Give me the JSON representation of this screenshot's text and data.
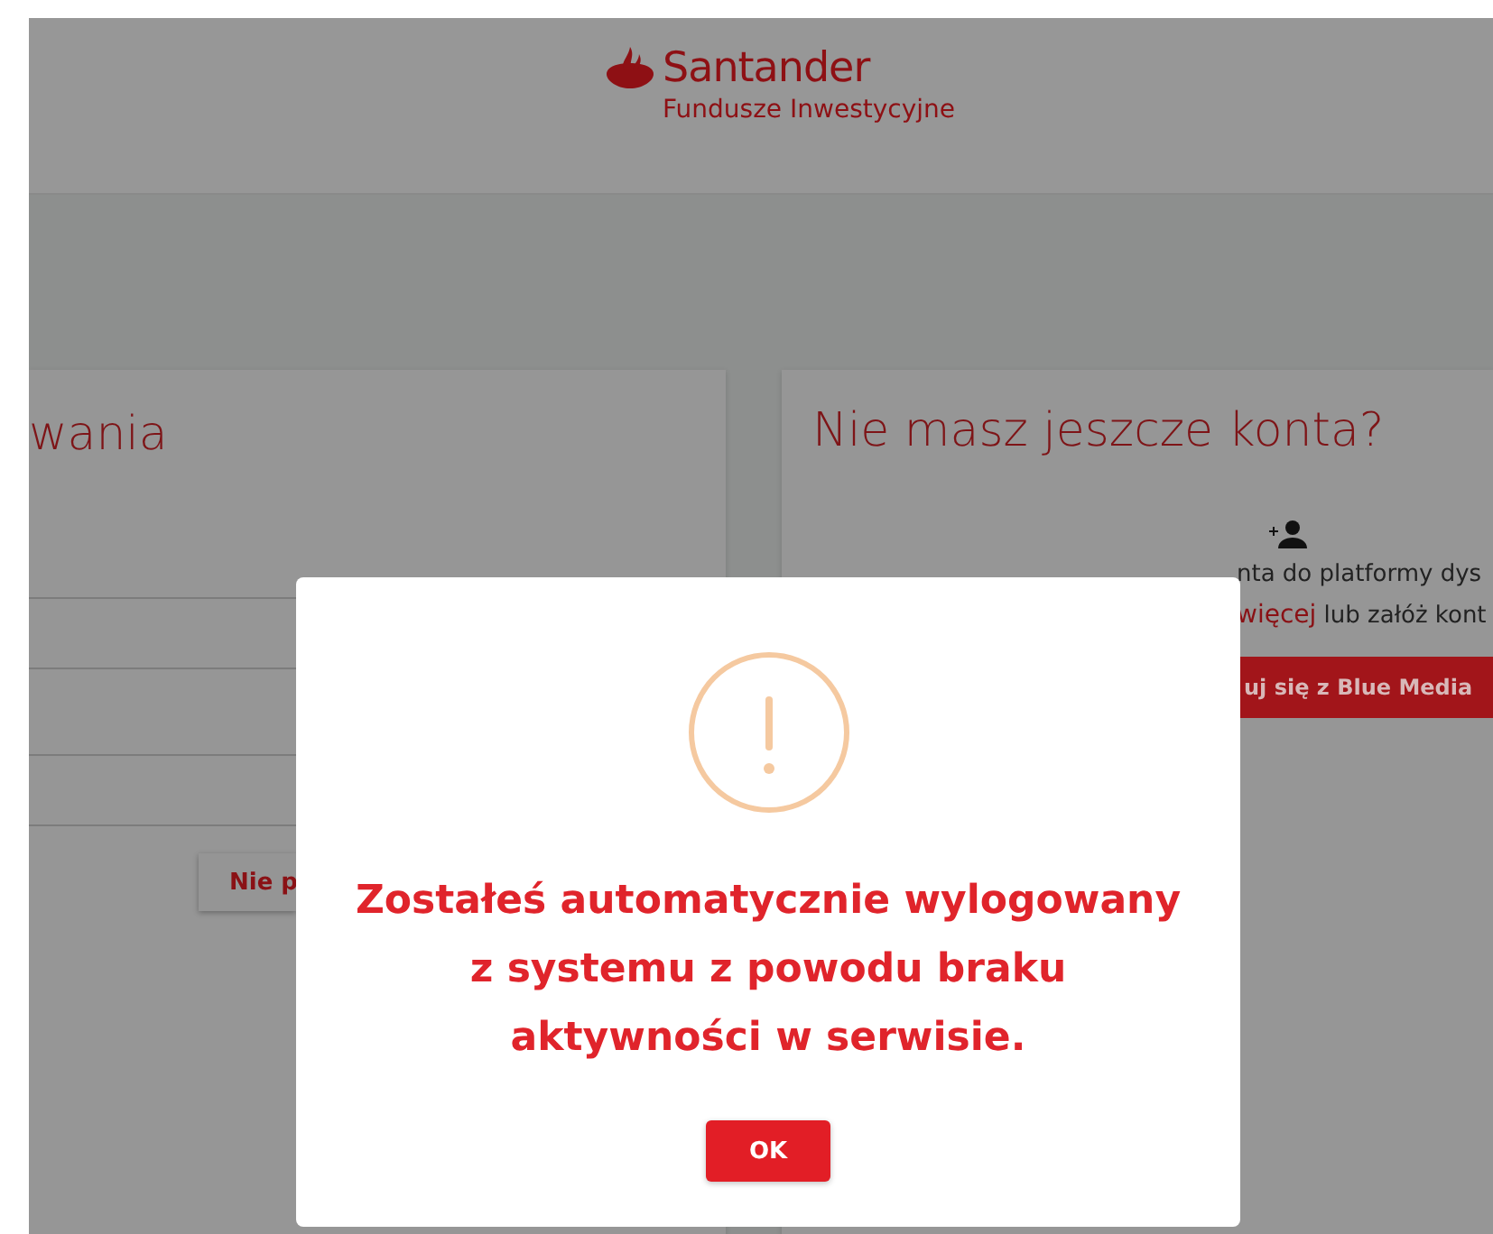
{
  "header": {
    "brand": "Santander",
    "subtitle": "Fundusze Inwestycyjne"
  },
  "login_card": {
    "title": "wania",
    "button": "Nie p"
  },
  "register_card": {
    "title": "Nie masz jeszcze konta?",
    "line_1": "nta do platformy dys",
    "line_2_link": "więcej",
    "line_2": "lub załóż kont",
    "button": "uj się z Blue Media"
  },
  "dialog": {
    "message": "Zostałeś automatycznie wylogowany z systemu z powodu braku aktywności w serwisie.",
    "button": "OK"
  }
}
